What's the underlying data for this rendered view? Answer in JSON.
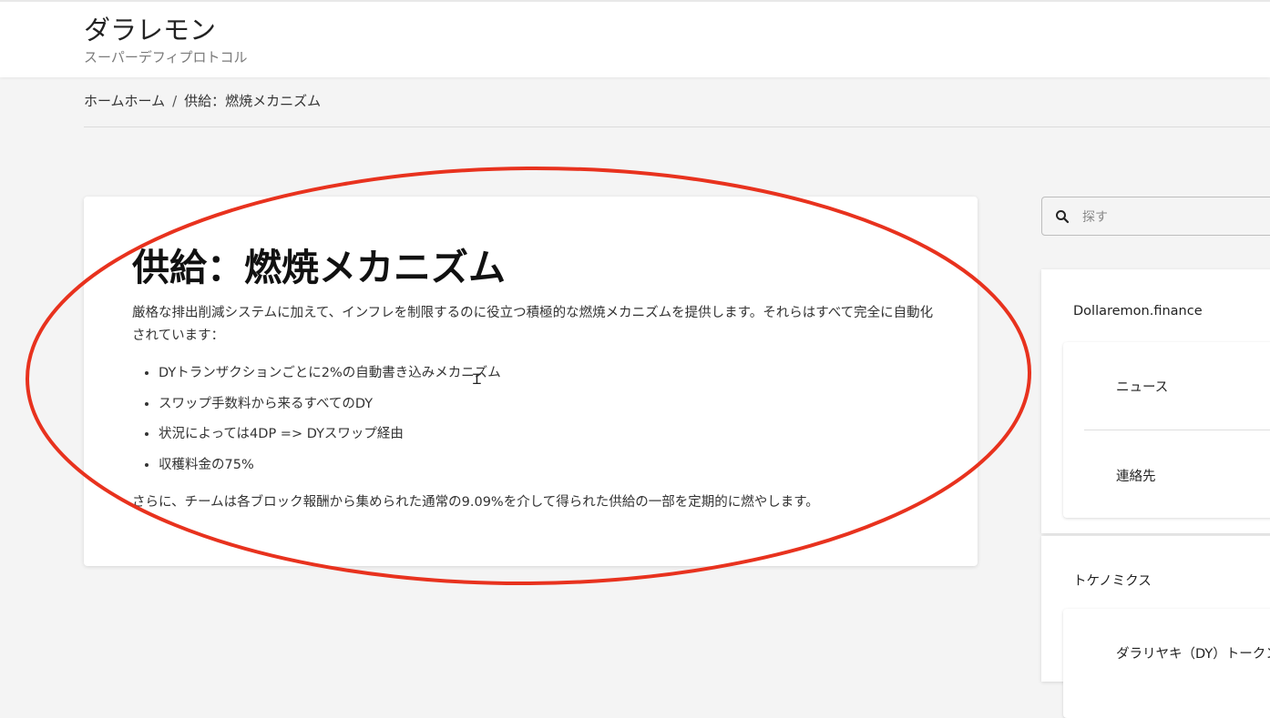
{
  "site": {
    "title": "ダラレモン",
    "subtitle": "スーパーデフィプロトコル"
  },
  "breadcrumb": {
    "home": "ホームホーム",
    "separator": "/",
    "current": "供給：燃焼メカニズム"
  },
  "post": {
    "title": "供給：燃焼メカニズム",
    "intro": "厳格な排出削減システムに加えて、インフレを制限するのに役立つ積極的な燃焼メカニズムを提供します。それらはすべて完全に自動化されています：",
    "bullets": [
      "DYトランザクションごとに2%の自動書き込みメカニズム",
      "スワップ手数料から来るすべてのDY",
      "状況によっては4DP => DYスワップ経由",
      "収穫料金の75%"
    ],
    "outro": "さらに、チームは各ブロック報酬から集められた通常の9.09%を介して得られた供給の一部を定期的に燃やします。"
  },
  "search": {
    "placeholder": "探す",
    "value": ""
  },
  "sidebar": {
    "widgets": [
      {
        "title": "Dollaremon.finance",
        "items": [
          "ニュース",
          "連絡先"
        ]
      },
      {
        "title": "トケノミクス",
        "items": [
          "ダラリヤキ（DY）トークン"
        ]
      }
    ]
  },
  "colors": {
    "annotation": "#e8321e",
    "background": "#f4f4f4",
    "card": "#ffffff"
  },
  "icons": {
    "search": "search-icon",
    "cursor": "text-cursor-icon"
  }
}
